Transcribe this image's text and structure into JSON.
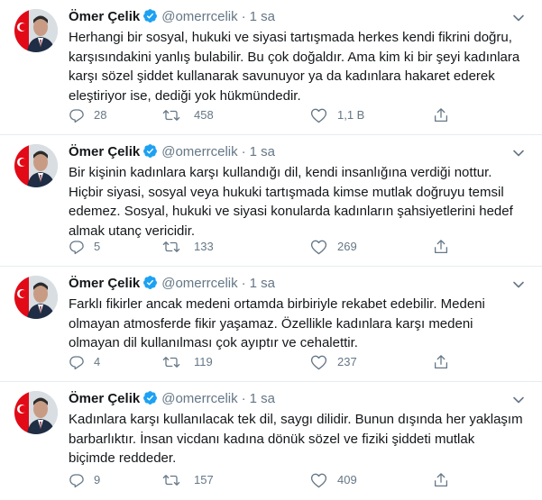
{
  "tweets": [
    {
      "name": "Ömer Çelik",
      "handle": "@omerrcelik",
      "separator": "·",
      "time": "1 sa",
      "text": "Herhangi bir sosyal, hukuki ve siyasi tartışmada herkes kendi fikrini doğru, karşısındakini yanlış bulabilir. Bu çok doğaldır. Ama kim ki bir şeyi kadınlara karşı sözel şiddet kullanarak savunuyor ya da kadınlara hakaret ederek eleştiriyor ise, dediği yok hükmündedir.",
      "replies": "28",
      "retweets": "458",
      "likes": "1,1 B"
    },
    {
      "name": "Ömer Çelik",
      "handle": "@omerrcelik",
      "separator": "·",
      "time": "1 sa",
      "text": "Bir kişinin kadınlara karşı kullandığı dil, kendi insanlığına verdiği nottur. Hiçbir siyasi, sosyal veya hukuki tartışmada kimse mutlak doğruyu temsil edemez. Sosyal, hukuki ve siyasi konularda kadınların şahsiyetlerini hedef almak utanç vericidir.",
      "replies": "5",
      "retweets": "133",
      "likes": "269"
    },
    {
      "name": "Ömer Çelik",
      "handle": "@omerrcelik",
      "separator": "·",
      "time": "1 sa",
      "text": "Farklı fikirler ancak medeni ortamda birbiriyle rekabet edebilir. Medeni olmayan atmosferde fikir yaşamaz. Özellikle kadınlara karşı medeni olmayan dil kullanılması çok ayıptır ve cehalettir.",
      "replies": "4",
      "retweets": "119",
      "likes": "237"
    },
    {
      "name": "Ömer Çelik",
      "handle": "@omerrcelik",
      "separator": "·",
      "time": "1 sa",
      "text": "Kadınlara karşı kullanılacak tek dil, saygı dilidir. Bunun dışında her yaklaşım barbarlıktır. İnsan vicdanı kadına dönük sözel ve fiziki şiddeti mutlak biçimde reddeder.",
      "replies": "9",
      "retweets": "157",
      "likes": "409"
    }
  ],
  "icons": {
    "verified": "verified-badge-icon",
    "caret": "chevron-down-icon",
    "reply": "reply-icon",
    "retweet": "retweet-icon",
    "like": "heart-icon",
    "share": "share-icon"
  },
  "colors": {
    "text": "#14171a",
    "secondary": "#657786",
    "verified": "#1da1f2",
    "divider": "#e6ecf0",
    "flag": "#e30a17"
  }
}
